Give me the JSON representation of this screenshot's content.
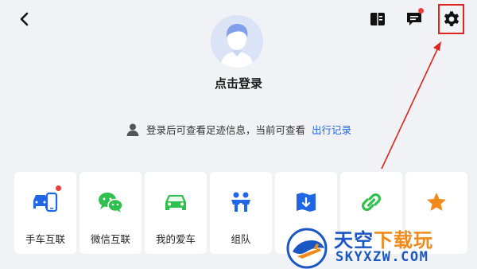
{
  "header": {
    "back_icon": "chevron-left-icon",
    "icons": [
      "book-icon",
      "message-icon",
      "settings-icon"
    ]
  },
  "profile": {
    "avatar_icon": "default-avatar",
    "login_text": "点击登录",
    "hint_text": "登录后可查看足迹信息，当前可查看",
    "hint_link": "出行记录"
  },
  "tiles": [
    {
      "label": "手车互联",
      "icon": "phone-car-icon",
      "badge": true
    },
    {
      "label": "微信互联",
      "icon": "wechat-icon",
      "badge": false
    },
    {
      "label": "我的爱车",
      "icon": "car-icon",
      "badge": false
    },
    {
      "label": "组队",
      "icon": "team-icon",
      "badge": false
    },
    {
      "label": "",
      "icon": "offline-map-icon",
      "badge": false
    },
    {
      "label": "",
      "icon": "link-icon",
      "badge": false
    },
    {
      "label": "",
      "icon": "star-icon",
      "badge": false
    }
  ],
  "watermark": {
    "title_part1": "天空",
    "title_part2": "下载玩",
    "subtitle": "SKYXZW.COM"
  },
  "colors": {
    "background": "#f1f2f6",
    "accent_blue": "#2266e8",
    "green": "#2fc04e",
    "orange": "#f28a1d",
    "highlight_red": "#e0231c"
  }
}
